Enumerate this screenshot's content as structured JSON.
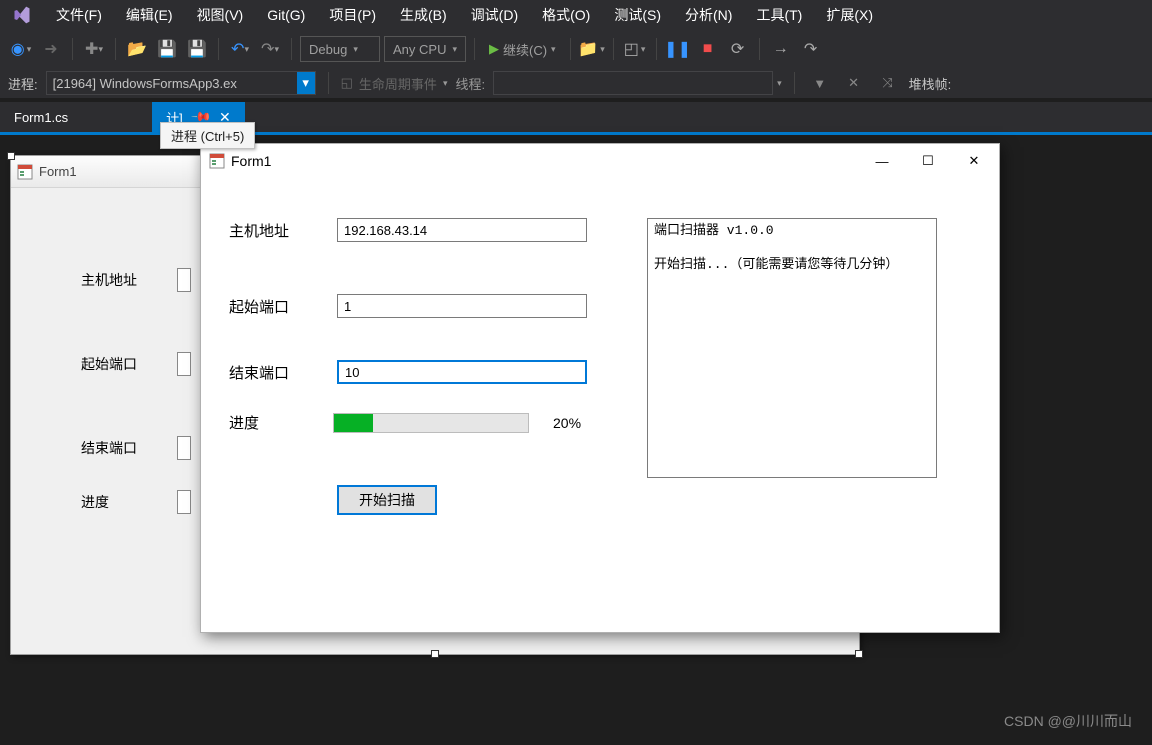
{
  "menu": {
    "file": "文件(F)",
    "edit": "编辑(E)",
    "view": "视图(V)",
    "git": "Git(G)",
    "project": "项目(P)",
    "build": "生成(B)",
    "debug": "调试(D)",
    "format": "格式(O)",
    "test": "测试(S)",
    "analyze": "分析(N)",
    "tools": "工具(T)",
    "extensions": "扩展(X)"
  },
  "toolbar": {
    "config": "Debug",
    "platform": "Any CPU",
    "continue": "继续(C)"
  },
  "process": {
    "label": "进程:",
    "value": "[21964] WindowsFormsApp3.ex",
    "lifecycle": "生命周期事件",
    "thread_label": "线程:",
    "stackframe": "堆栈帧:"
  },
  "tooltip": "进程 (Ctrl+5)",
  "tabs": {
    "inactive": "Form1.cs",
    "active_suffix": "计]"
  },
  "form_designer": {
    "title": "Form1",
    "host_label": "主机地址",
    "start_label": "起始端口",
    "end_label": "结束端口",
    "progress_label": "进度"
  },
  "form_run": {
    "title": "Form1",
    "host_label": "主机地址",
    "host_value": "192.168.43.14",
    "start_label": "起始端口",
    "start_value": "1",
    "end_label": "结束端口",
    "end_value": "10",
    "progress_label": "进度",
    "progress_text": "20%",
    "scan_button": "开始扫描",
    "output": "端口扫描器 v1.0.0\n\n开始扫描...（可能需要请您等待几分钟）"
  },
  "watermark": "CSDN @@川川而山"
}
